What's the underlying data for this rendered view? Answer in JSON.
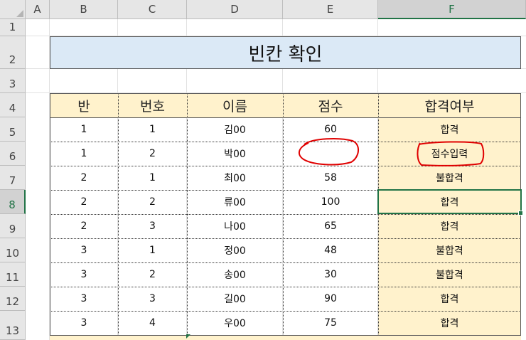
{
  "columns": [
    "A",
    "B",
    "C",
    "D",
    "E",
    "F"
  ],
  "rows": [
    "1",
    "2",
    "3",
    "4",
    "5",
    "6",
    "7",
    "8",
    "9",
    "10",
    "11",
    "12",
    "13"
  ],
  "title": "빈칸 확인",
  "headers": [
    "반",
    "번호",
    "이름",
    "점수",
    "합격여부"
  ],
  "table": [
    [
      "1",
      "1",
      "김00",
      "60",
      "합격"
    ],
    [
      "1",
      "2",
      "박00",
      "",
      "점수입력"
    ],
    [
      "2",
      "1",
      "최00",
      "58",
      "불합격"
    ],
    [
      "2",
      "2",
      "류00",
      "100",
      "합격"
    ],
    [
      "2",
      "3",
      "나00",
      "65",
      "합격"
    ],
    [
      "3",
      "1",
      "정00",
      "48",
      "불합격"
    ],
    [
      "3",
      "2",
      "송00",
      "30",
      "불합격"
    ],
    [
      "3",
      "3",
      "길00",
      "90",
      "합격"
    ],
    [
      "3",
      "4",
      "우00",
      "75",
      "합격"
    ]
  ],
  "colors": {
    "header_fill": "#fff2cc",
    "title_fill": "#dbe9f6",
    "selection": "#217346",
    "annotation": "#e00000"
  }
}
